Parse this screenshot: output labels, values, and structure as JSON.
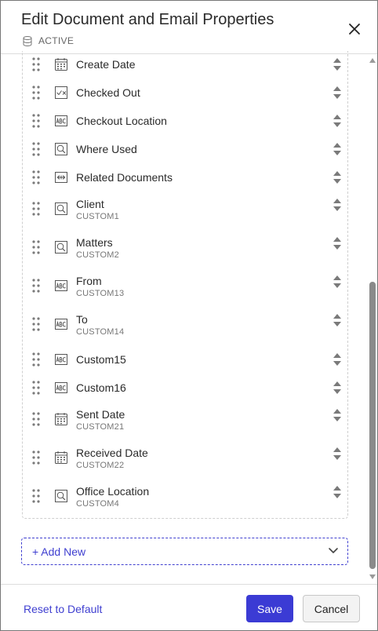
{
  "header": {
    "title": "Edit Document and Email Properties",
    "database_label": "ACTIVE",
    "database_icon": "database-icon",
    "close_icon": "close-icon"
  },
  "fields": [
    {
      "label": "Create Date",
      "sub": "",
      "icon": "calendar-icon"
    },
    {
      "label": "Checked Out",
      "sub": "",
      "icon": "checkbox-icon"
    },
    {
      "label": "Checkout Location",
      "sub": "",
      "icon": "text-field-icon"
    },
    {
      "label": "Where Used",
      "sub": "",
      "icon": "search-field-icon"
    },
    {
      "label": "Related Documents",
      "sub": "",
      "icon": "related-link-icon"
    },
    {
      "label": "Client",
      "sub": "CUSTOM1",
      "icon": "search-field-icon"
    },
    {
      "label": "Matters",
      "sub": "CUSTOM2",
      "icon": "search-field-icon"
    },
    {
      "label": "From",
      "sub": "CUSTOM13",
      "icon": "text-field-icon"
    },
    {
      "label": "To",
      "sub": "CUSTOM14",
      "icon": "text-field-icon"
    },
    {
      "label": "Custom15",
      "sub": "",
      "icon": "text-field-icon"
    },
    {
      "label": "Custom16",
      "sub": "",
      "icon": "text-field-icon"
    },
    {
      "label": "Sent Date",
      "sub": "CUSTOM21",
      "icon": "calendar-icon"
    },
    {
      "label": "Received Date",
      "sub": "CUSTOM22",
      "icon": "calendar-icon"
    },
    {
      "label": "Office Location",
      "sub": "CUSTOM4",
      "icon": "search-field-icon"
    }
  ],
  "add_new": {
    "label": "+ Add New"
  },
  "footer": {
    "reset_label": "Reset to Default",
    "save_label": "Save",
    "cancel_label": "Cancel"
  },
  "colors": {
    "accent": "#3b3bd4",
    "link": "#3f3fd0",
    "icon_gray": "#8a8a8a"
  }
}
